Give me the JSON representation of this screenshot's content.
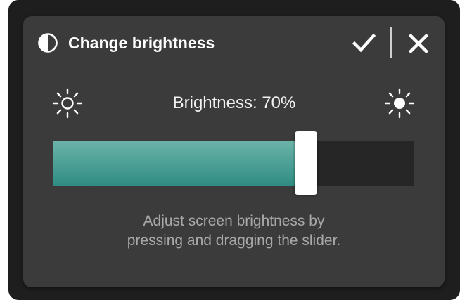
{
  "dialog": {
    "title": "Change brightness",
    "header_icon": "contrast-icon",
    "confirm_icon": "checkmark-icon",
    "close_icon": "close-icon"
  },
  "brightness": {
    "label": "Brightness: 70%",
    "value_percent": 70,
    "min_icon": "sun-dim-icon",
    "max_icon": "sun-bright-icon"
  },
  "help": {
    "line1": "Adjust screen brightness by",
    "line2": "pressing and dragging the slider."
  },
  "colors": {
    "dialog_bg": "#3b3b3b",
    "frame_bg": "#1e1e1e",
    "fill_top": "#6bb3a9",
    "fill_bottom": "#2f8c82",
    "track_bg": "#262626",
    "text": "#ffffff",
    "help_text": "#a9a9a9"
  }
}
